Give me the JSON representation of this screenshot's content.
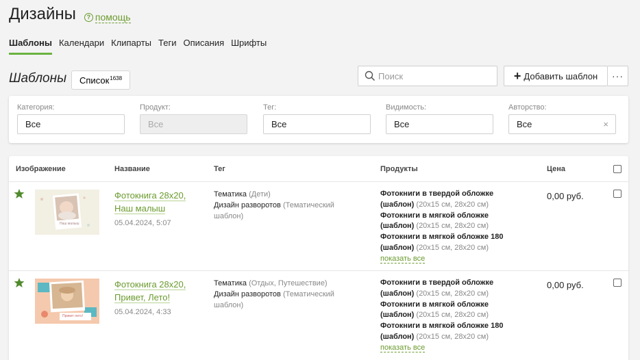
{
  "header": {
    "title": "Дизайны",
    "help_label": "помощь"
  },
  "tabs": [
    "Шаблоны",
    "Календари",
    "Клипарты",
    "Теги",
    "Описания",
    "Шрифты"
  ],
  "toolbar": {
    "section_title": "Шаблоны",
    "list_label": "Список",
    "list_count": "1638",
    "search_placeholder": "Поиск",
    "add_label": "Добавить шаблон",
    "more_label": "···"
  },
  "filters": [
    {
      "label": "Категория:",
      "value": "Все",
      "disabled": false
    },
    {
      "label": "Продукт:",
      "value": "Все",
      "disabled": true
    },
    {
      "label": "Тег:",
      "value": "Все",
      "disabled": false
    },
    {
      "label": "Видимость:",
      "value": "Все",
      "disabled": false
    },
    {
      "label": "Авторство:",
      "value": "Все",
      "disabled": false,
      "clearable": true,
      "clear_label": "×"
    }
  ],
  "table": {
    "columns": [
      "Изображение",
      "Название",
      "Тег",
      "Продукты",
      "Цена"
    ],
    "rows": [
      {
        "starred": true,
        "thumb_style": "baby",
        "thumb_text": "Наш малыш",
        "name": [
          "Фотокнига 28х20,",
          "Наш малыш"
        ],
        "date": "05.04.2024, 5:07",
        "tags": [
          {
            "name": "Тематика",
            "detail": "(Дети)"
          },
          {
            "name": "Дизайн разворотов",
            "detail": "(Тематический шаблон)"
          }
        ],
        "products": [
          {
            "name": "Фотокниги в твердой обложке (шаблон)",
            "detail": "(20x15 см, 28x20 см)"
          },
          {
            "name": "Фотокниги в мягкой обложке (шаблон)",
            "detail": "(20x15 см, 28x20 см)"
          },
          {
            "name": "Фотокниги в мягкой обложке 180 (шаблон)",
            "detail": "(20x15 см, 28x20 см)"
          }
        ],
        "show_all": "показать все",
        "price": "0,00 руб."
      },
      {
        "starred": true,
        "thumb_style": "summer",
        "thumb_text": "Привет лето!",
        "name": [
          "Фотокнига 28х20,",
          "Привет, Лето!"
        ],
        "date": "05.04.2024, 4:33",
        "tags": [
          {
            "name": "Тематика",
            "detail": "(Отдых, Путешествие)"
          },
          {
            "name": "Дизайн разворотов",
            "detail": "(Тематический шаблон)"
          }
        ],
        "products": [
          {
            "name": "Фотокниги в твердой обложке (шаблон)",
            "detail": "(20x15 см, 28x20 см)"
          },
          {
            "name": "Фотокниги в мягкой обложке (шаблон)",
            "detail": "(20x15 см, 28x20 см)"
          },
          {
            "name": "Фотокниги в мягкой обложке 180 (шаблон)",
            "detail": "(20x15 см, 28x20 см)"
          }
        ],
        "show_all": "показать все",
        "price": "0,00 руб."
      }
    ]
  },
  "colors": {
    "accent": "#6b9b2f",
    "tab_underline": "#6ab23f",
    "star": "#4f8a2b"
  }
}
